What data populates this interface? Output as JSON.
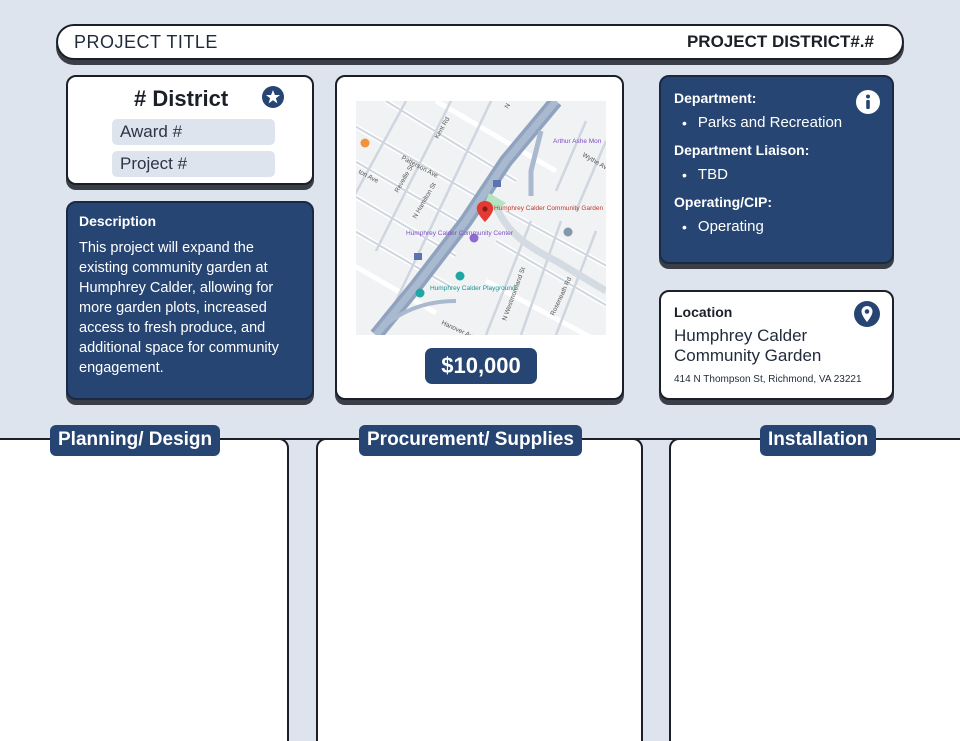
{
  "header": {
    "title": "PROJECT TITLE",
    "district": "PROJECT DISTRICT#.#"
  },
  "district_card": {
    "heading": "# District",
    "icon": "star-icon",
    "award_label": "Award #",
    "project_label": "Project #"
  },
  "description": {
    "label": "Description",
    "text": "This project will expand the existing community garden at Humphrey Calder, allowing for more garden plots, increased access to fresh produce, and additional space for community engagement."
  },
  "map": {
    "pin_label": "Humphrey Calder Community Garden",
    "center_label": "Humphrey Calder Community Center",
    "playground_label": "Humphrey Calder Playground",
    "streets": {
      "patterson": "Patterson Ave",
      "kent": "Kent Rd",
      "reveille": "Reveille St",
      "hamilton": "N Hamilton St",
      "westmoreland": "N Westmoreland St",
      "hanover": "Hanover Ave",
      "wythe": "Wythe Ave",
      "arthur_ashe": "Arthur Ashe Mon",
      "ton": "ton Ave",
      "roseneath": "Roseneath Rd",
      "n": "N"
    },
    "price": "$10,000"
  },
  "department": {
    "dept_label": "Department:",
    "dept_value": "Parks and Recreation",
    "liaison_label": "Department Liaison:",
    "liaison_value": "TBD",
    "type_label": "Operating/CIP:",
    "type_value": "Operating",
    "icon": "info-icon"
  },
  "location": {
    "label": "Location",
    "name": "Humphrey Calder Community Garden",
    "address": "414 N Thompson St, Richmond, VA 23221",
    "icon": "location-pin-icon"
  },
  "phases": {
    "planning": "Planning/ Design",
    "procurement": "Procurement/ Supplies",
    "installation": "Installation"
  },
  "colors": {
    "navy": "#264573",
    "background": "#dde4ee",
    "pill": "#dde4ee"
  }
}
